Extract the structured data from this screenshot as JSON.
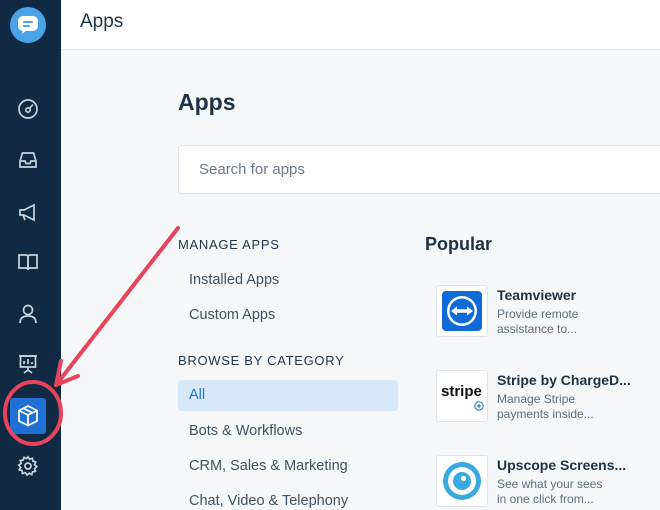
{
  "header": {
    "title": "Apps"
  },
  "sidebar": {
    "logo_icon": "chat-bubble-icon",
    "items": [
      {
        "icon": "dashboard-icon"
      },
      {
        "icon": "inbox-icon"
      },
      {
        "icon": "campaigns-megaphone-icon"
      },
      {
        "icon": "knowledge-base-book-icon"
      },
      {
        "icon": "contacts-person-icon"
      },
      {
        "icon": "reports-board-icon"
      },
      {
        "icon": "apps-box-icon",
        "active": true
      },
      {
        "icon": "settings-gear-icon"
      }
    ]
  },
  "main": {
    "title": "Apps",
    "search": {
      "placeholder": "Search for apps",
      "value": ""
    },
    "manage": {
      "heading": "MANAGE APPS",
      "items": [
        "Installed Apps",
        "Custom Apps"
      ]
    },
    "browse": {
      "heading": "BROWSE BY CATEGORY",
      "items": [
        "All",
        "Bots & Workflows",
        "CRM, Sales & Marketing",
        "Chat, Video & Telephony"
      ],
      "selected": "All"
    },
    "popular": {
      "heading": "Popular",
      "apps": [
        {
          "name": "Teamviewer",
          "description": "Provide remote assistance to...",
          "logo": "teamviewer-logo"
        },
        {
          "name": "Stripe by ChargeD...",
          "description": "Manage Stripe payments inside...",
          "logo": "stripe-logo",
          "logo_text": "stripe"
        },
        {
          "name": "Upscope Screens...",
          "description": "See what your sees in one click from...",
          "logo": "upscope-logo"
        }
      ]
    }
  },
  "colors": {
    "sidebar": "#102a43",
    "accent": "#1f6fd4",
    "annotation": "#e8435a",
    "selected_bg": "#d6e7f8"
  }
}
